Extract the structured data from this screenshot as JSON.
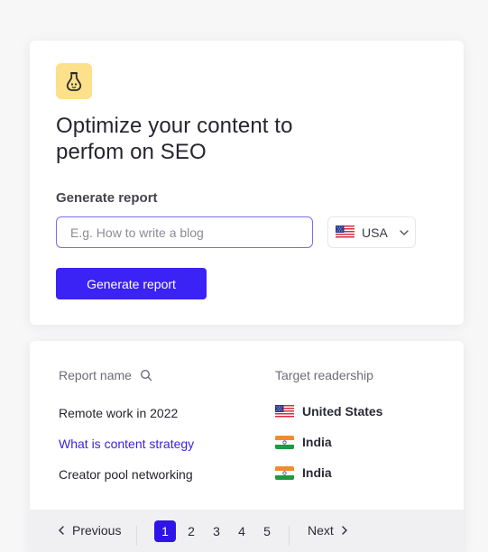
{
  "hero": {
    "logo_icon": "flask-face-icon",
    "headline_line1": "Optimize your content to",
    "headline_line2": "perfom on SEO",
    "section_label": "Generate report",
    "input_placeholder": "E.g. How to write a blog",
    "input_value": "",
    "country": "USA",
    "button_label": "Generate report"
  },
  "table": {
    "columns": [
      "Report name",
      "Target readership"
    ],
    "rows": [
      {
        "name": "Remote work in 2022",
        "target": "United States",
        "flag": "us-flag-icon"
      },
      {
        "name": "What is content strategy",
        "target": "India",
        "flag": "india-flag-icon"
      },
      {
        "name": "Creator pool networking",
        "target": "India",
        "flag": "india-flag-icon"
      }
    ]
  },
  "pagination": {
    "prev": "Previous",
    "next": "Next",
    "pages": [
      "1",
      "2",
      "3",
      "4",
      "5"
    ],
    "current": "1"
  },
  "colors": {
    "accent": "#3b22f5",
    "link": "#3b22e0",
    "logo_bg": "#fde08a",
    "input_border": "#7b6cf4"
  }
}
